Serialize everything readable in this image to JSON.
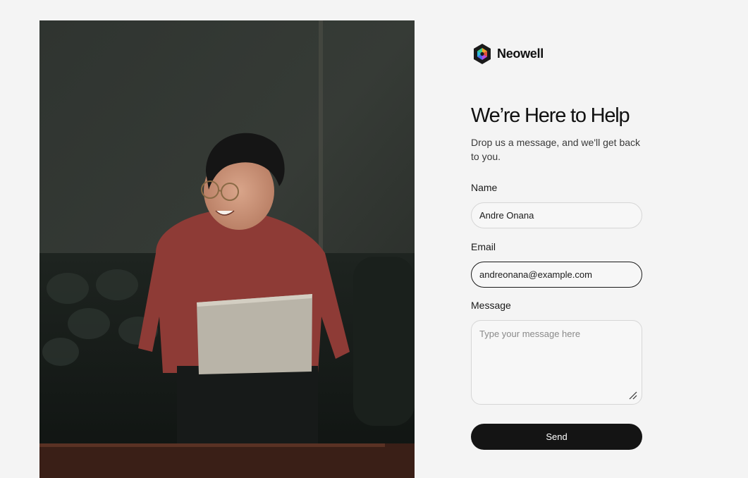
{
  "brand": {
    "name": "Neowell",
    "logo_icon": "hexagon-logo-icon"
  },
  "hero": {
    "title": "We’re Here to Help",
    "subtitle": "Drop us a message, and we'll get back to you."
  },
  "form": {
    "name": {
      "label": "Name",
      "value": "Andre Onana"
    },
    "email": {
      "label": "Email",
      "value": "andreonana@example.com"
    },
    "message": {
      "label": "Message",
      "placeholder": "Type your message here",
      "value": ""
    },
    "submit_label": "Send"
  },
  "colors": {
    "background": "#f4f4f4",
    "button": "#141414",
    "field_border": "#d6d6d6",
    "active_border": "#1a1a1a"
  }
}
